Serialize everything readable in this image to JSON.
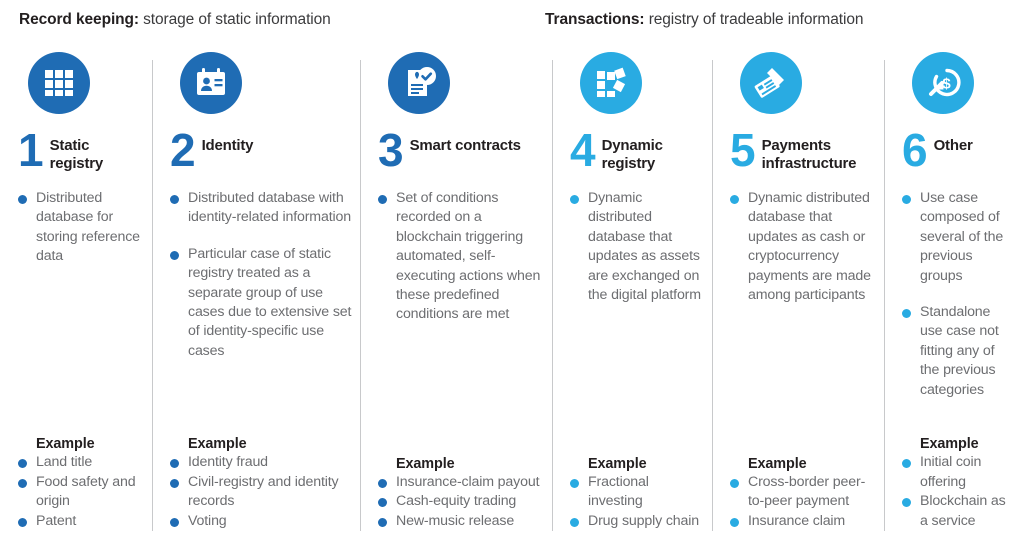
{
  "headers": {
    "record_keeping": {
      "strong": "Record keeping:",
      "rest": " storage of static information"
    },
    "transactions": {
      "strong": "Transactions:",
      "rest": " registry of tradeable information"
    }
  },
  "colors": {
    "dark_blue": "#1F6CB4",
    "light_blue": "#29ABE2",
    "text_gray": "#6d6e71",
    "heading_black": "#231f20",
    "divider_gray": "#c8c9cb"
  },
  "example_label": "Example",
  "columns": [
    {
      "number": "1",
      "title": "Static registry",
      "icon": "grid-icon",
      "color": "#1F6CB4",
      "bullets": [
        "Distributed database for storing reference data"
      ],
      "example_label": "Example",
      "examples": [
        "Land title",
        "Food safety and origin",
        "Patent"
      ]
    },
    {
      "number": "2",
      "title": "Identity",
      "icon": "id-badge-icon",
      "color": "#1F6CB4",
      "bullets": [
        "Distributed database with identity-related information",
        "Particular case of static registry treated as a separate group of use cases due to extensive set of identity-specific use cases"
      ],
      "example_label": "Example",
      "examples": [
        "Identity fraud",
        "Civil-registry and identity records",
        "Voting"
      ]
    },
    {
      "number": "3",
      "title": "Smart contracts",
      "icon": "document-check-icon",
      "color": "#1F6CB4",
      "bullets": [
        "Set of conditions recorded on a blockchain triggering automated, self-executing actions when these predefined conditions are met"
      ],
      "example_label": "Example",
      "examples": [
        "Insurance-claim payout",
        "Cash-equity trading",
        "New-music release"
      ]
    },
    {
      "number": "4",
      "title": "Dynamic registry",
      "icon": "dynamic-grid-icon",
      "color": "#29ABE2",
      "bullets": [
        "Dynamic distributed database that updates as assets are exchanged on the digital platform"
      ],
      "example_label": "Example",
      "examples": [
        "Fractional investing",
        "Drug supply chain"
      ]
    },
    {
      "number": "5",
      "title": "Payments infrastructure",
      "icon": "card-swipe-icon",
      "color": "#29ABE2",
      "bullets": [
        "Dynamic distributed database that updates as cash or cryptocurrency payments are made among participants"
      ],
      "example_label": "Example",
      "examples": [
        "Cross-border peer-to-peer payment",
        "Insurance claim"
      ]
    },
    {
      "number": "6",
      "title": "Other",
      "icon": "dollar-arrow-icon",
      "color": "#29ABE2",
      "bullets": [
        "Use case composed of several of the previous groups",
        "Standalone use case not fitting any of the previous categories"
      ],
      "example_label": "Example",
      "examples": [
        "Initial coin offering",
        "Blockchain as a service"
      ]
    }
  ]
}
